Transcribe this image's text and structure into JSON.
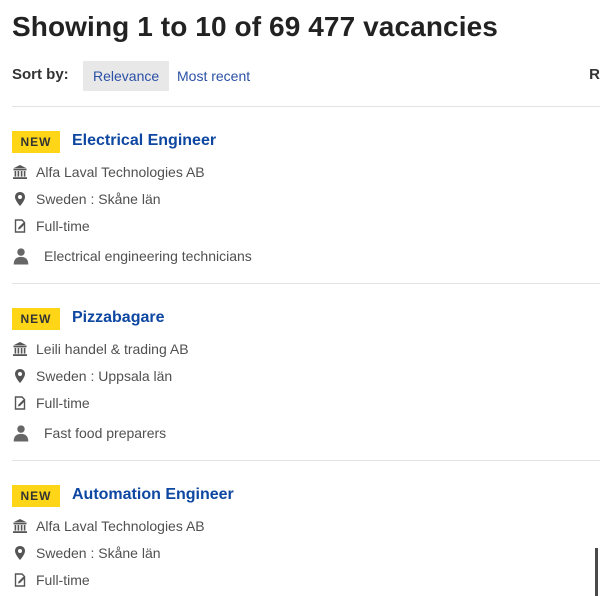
{
  "header": {
    "title": "Showing 1 to 10 of 69 477 vacancies"
  },
  "sort": {
    "label": "Sort by:",
    "options": [
      "Relevance",
      "Most recent"
    ],
    "selected": "Relevance",
    "truncated_right": "R"
  },
  "colors": {
    "badge": "#ffd617",
    "title_link": "#0e47a1",
    "sort_link": "#2a50a6",
    "selected_bg": "#e8e8e8"
  },
  "results": [
    {
      "badge": "NEW",
      "title": "Electrical Engineer",
      "employer": "Alfa Laval Technologies AB",
      "location": "Sweden : Skåne län",
      "contract": "Full-time",
      "occupation": "Electrical engineering technicians"
    },
    {
      "badge": "NEW",
      "title": "Pizzabagare",
      "employer": "Leili handel & trading AB",
      "location": "Sweden : Uppsala län",
      "contract": "Full-time",
      "occupation": "Fast food preparers"
    },
    {
      "badge": "NEW",
      "title": "Automation Engineer",
      "employer": "Alfa Laval Technologies AB",
      "location": "Sweden : Skåne län",
      "contract": "Full-time"
    }
  ],
  "icons": {
    "employer": "building-icon",
    "location": "map-pin-icon",
    "contract": "document-edit-icon",
    "occupation": "person-icon"
  }
}
